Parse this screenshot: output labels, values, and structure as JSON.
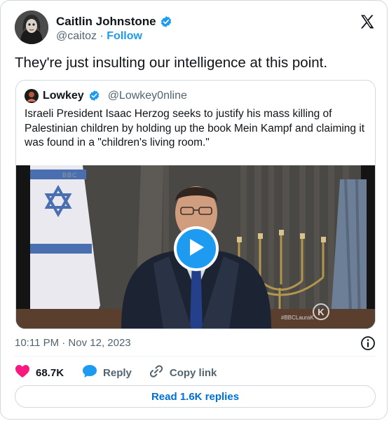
{
  "author": {
    "name": "Caitlin Johnstone",
    "handle": "@caitoz",
    "separator": "·",
    "follow_label": "Follow",
    "verified": true
  },
  "tweet": {
    "text": "They're just insulting our intelligence at this point."
  },
  "quoted_tweet": {
    "name": "Lowkey",
    "handle": "@Lowkey0nline",
    "text": "Israeli President Isaac Herzog seeks to justify his mass killing of Palestinian children by holding up the book Mein Kampf and claiming it was found in a \"children's living room.\"",
    "video": {
      "corner_mark": "BBC",
      "hashtag": "#BBCLauraK",
      "logo_letter": "K"
    }
  },
  "meta": {
    "timestamp": "10:11 PM · Nov 12, 2023"
  },
  "actions": {
    "likes": "68.7K",
    "reply_label": "Reply",
    "copy_link_label": "Copy link",
    "read_replies_label": "Read 1.6K replies"
  },
  "colors": {
    "accent": "#1d9bf0",
    "like": "#f91880",
    "muted": "#536471",
    "link": "#006fd6"
  },
  "icons": {
    "brand": "x-logo-icon",
    "verified": "verified-badge-icon",
    "info": "info-icon",
    "like": "heart-icon",
    "reply": "speech-bubble-icon",
    "copy": "link-icon",
    "play": "play-icon"
  }
}
